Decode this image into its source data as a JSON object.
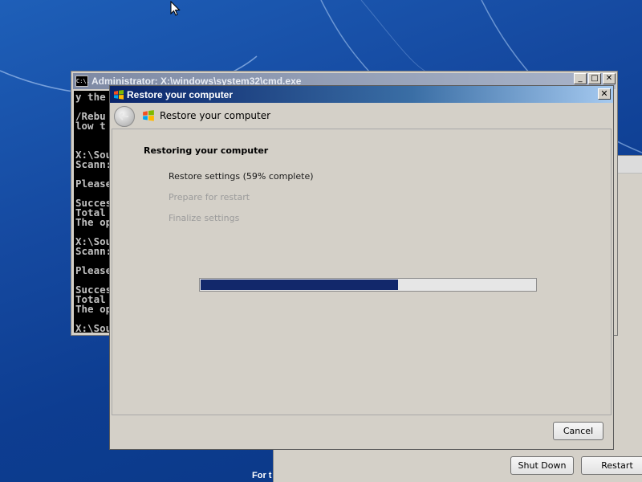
{
  "desktop": {
    "footer_text": "For t"
  },
  "cmd_window": {
    "title": "Administrator: X:\\windows\\system32\\cmd.exe",
    "icon_label": "C:\\.",
    "buttons": {
      "minimize": "_",
      "maximize": "□",
      "close": "✕"
    },
    "console_lines": [
      "y the",
      "",
      "/Rebu",
      "low t",
      "",
      "",
      "X:\\Sou",
      "Scann:",
      "",
      "Please",
      "",
      "Succes",
      "Total",
      "The op",
      "",
      "X:\\Sou",
      "Scann:",
      "",
      "Please",
      "",
      "Succes",
      "Total",
      "The op",
      "",
      "X:\\Sou"
    ]
  },
  "setup_window": {
    "shutdown_label": "Shut Down",
    "restart_label": "Restart"
  },
  "restore_dialog": {
    "title": "Restore your computer",
    "close_glyph": "✕",
    "header_title": "Restore your computer",
    "heading": "Restoring your computer",
    "steps": [
      {
        "label": "Restore settings (59% complete)",
        "state": "active"
      },
      {
        "label": "Prepare for restart",
        "state": "inactive"
      },
      {
        "label": "Finalize settings",
        "state": "inactive"
      }
    ],
    "progress_percent": 59,
    "cancel_label": "Cancel"
  },
  "colors": {
    "desktop_blue": "#1549a0",
    "progress_fill": "#12286b",
    "dialog_face": "#d4d0c8"
  },
  "icons": [
    "windows-flag-icon",
    "back-arrow-icon",
    "cmd-icon",
    "mouse-cursor-icon",
    "close-icon"
  ]
}
